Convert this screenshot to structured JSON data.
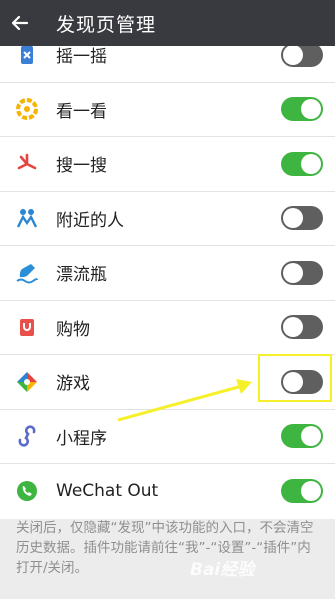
{
  "header": {
    "title": "发现页管理",
    "back_icon": "arrow-left-icon"
  },
  "items": [
    {
      "label": "摇一摇",
      "icon": "shake-icon",
      "enabled": false
    },
    {
      "label": "看一看",
      "icon": "top-stories-icon",
      "enabled": true
    },
    {
      "label": "搜一搜",
      "icon": "search-icon",
      "enabled": true
    },
    {
      "label": "附近的人",
      "icon": "people-nearby-icon",
      "enabled": false
    },
    {
      "label": "漂流瓶",
      "icon": "drift-bottle-icon",
      "enabled": false
    },
    {
      "label": "购物",
      "icon": "shopping-icon",
      "enabled": false
    },
    {
      "label": "游戏",
      "icon": "games-icon",
      "enabled": false
    },
    {
      "label": "小程序",
      "icon": "mini-program-icon",
      "enabled": true
    },
    {
      "label": "WeChat Out",
      "icon": "wechat-out-icon",
      "enabled": true
    }
  ],
  "footer_note": "关闭后，仅隐藏“发现”中该功能的入口，不会清空历史数据。插件功能请前往“我”-“设置”-“插件”内打开/关闭。",
  "watermark": "Bai经验",
  "colors": {
    "header_bg": "#393a3f",
    "toggle_on": "#3fb541",
    "toggle_off": "#5f5f5f",
    "annotation": "#f5f02a"
  }
}
